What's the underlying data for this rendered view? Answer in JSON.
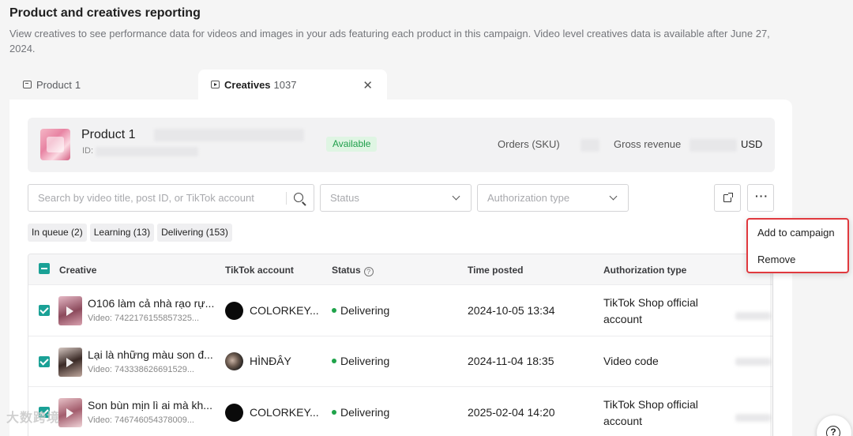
{
  "page": {
    "title": "Product and creatives reporting",
    "description": "View creatives to see performance data for videos and images in your ads featuring each product in this campaign. Video level creatives data is available after June 27, 2024."
  },
  "tabs": [
    {
      "label": "Product",
      "count": "1",
      "active": false
    },
    {
      "label": "Creatives",
      "count": "1037",
      "active": true
    }
  ],
  "tab_close_glyph": "✕",
  "product": {
    "name": "Product 1",
    "id_label": "ID:",
    "status_badge": "Available",
    "orders_label": "Orders (SKU)",
    "revenue_label": "Gross revenue",
    "currency": "USD"
  },
  "filters": {
    "search_placeholder": "Search by video title, post ID, or TikTok account",
    "status_placeholder": "Status",
    "authorization_placeholder": "Authorization type",
    "more_glyph": "···"
  },
  "chips": [
    "In queue (2)",
    "Learning (13)",
    "Delivering (153)"
  ],
  "more_menu": [
    "Add to campaign",
    "Remove"
  ],
  "table": {
    "columns": [
      "Creative",
      "TikTok account",
      "Status",
      "Time posted",
      "Authorization type"
    ],
    "rows": [
      {
        "title": "O106 làm cả nhà rạo rự...",
        "video_id": "Video: 7422176155857325...",
        "account": "COLORKEY...",
        "status": "Delivering",
        "time": "2024-10-05 13:34",
        "auth": "TikTok Shop official account"
      },
      {
        "title": "Lại là những màu son đ...",
        "video_id": "Video: 743338626691529...",
        "account": "HÌNĐÂY",
        "status": "Delivering",
        "time": "2024-11-04 18:35",
        "auth": "Video code"
      },
      {
        "title": "Son bùn mịn lì ai mà kh...",
        "video_id": "Video: 746746054378009...",
        "account": "COLORKEY...",
        "status": "Delivering",
        "time": "2025-02-04 14:20",
        "auth": "TikTok Shop official account"
      }
    ]
  },
  "help_glyph": "?",
  "watermark": "大数跨境",
  "colors": {
    "accent_teal": "#1aa196",
    "status_green": "#1fa34a",
    "highlight_red": "#e0393e"
  }
}
